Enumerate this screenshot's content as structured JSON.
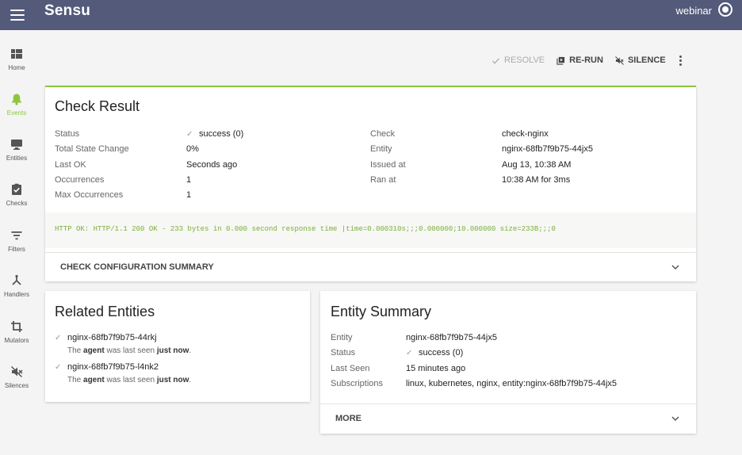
{
  "app": {
    "logo": "Sensu",
    "user": "webinar"
  },
  "sidebar": {
    "items": [
      {
        "label": "Home",
        "icon": "dashboard-icon"
      },
      {
        "label": "Events",
        "icon": "bell-icon",
        "active": true
      },
      {
        "label": "Entities",
        "icon": "monitor-icon"
      },
      {
        "label": "Checks",
        "icon": "clipboard-check-icon"
      },
      {
        "label": "Filters",
        "icon": "filter-icon"
      },
      {
        "label": "Handlers",
        "icon": "fork-icon"
      },
      {
        "label": "Mutators",
        "icon": "crop-icon"
      },
      {
        "label": "Silences",
        "icon": "mute-icon"
      }
    ]
  },
  "toolbar": {
    "resolve": "RESOLVE",
    "rerun": "RE-RUN",
    "silence": "SILENCE"
  },
  "check_result": {
    "title": "Check Result",
    "left": [
      {
        "key": "Status",
        "value": "success (0)"
      },
      {
        "key": "Total State Change",
        "value": "0%"
      },
      {
        "key": "Last OK",
        "value": "Seconds ago"
      },
      {
        "key": "Occurrences",
        "value": "1"
      },
      {
        "key": "Max Occurrences",
        "value": "1"
      }
    ],
    "right": [
      {
        "key": "Check",
        "value": "check-nginx"
      },
      {
        "key": "Entity",
        "value": "nginx-68fb7f9b75-44jx5"
      },
      {
        "key": "Issued at",
        "value": "Aug 13, 10:38 AM"
      },
      {
        "key": "Ran at",
        "value": "10:38 AM for 3ms"
      }
    ],
    "output": "HTTP OK: HTTP/1.1 200 OK - 233 bytes in 0.000 second response time |time=0.000310s;;;0.000000;10.000000 size=233B;;;0",
    "config_summary": "CHECK CONFIGURATION SUMMARY"
  },
  "related_entities": {
    "title": "Related Entities",
    "items": [
      {
        "name": "nginx-68fb7f9b75-44rkj",
        "pre": "The",
        "agent": "agent",
        "mid": "was last seen",
        "when": "just now",
        "post": "."
      },
      {
        "name": "nginx-68fb7f9b75-l4nk2",
        "pre": "The",
        "agent": "agent",
        "mid": "was last seen",
        "when": "just now",
        "post": "."
      }
    ]
  },
  "entity_summary": {
    "title": "Entity Summary",
    "rows": [
      {
        "key": "Entity",
        "value": "nginx-68fb7f9b75-44jx5"
      },
      {
        "key": "Status",
        "value": "success (0)"
      },
      {
        "key": "Last Seen",
        "value": "15 minutes ago"
      },
      {
        "key": "Subscriptions",
        "value": "linux, kubernetes, nginx, entity:nginx-68fb7f9b75-44jx5"
      }
    ],
    "more": "MORE"
  },
  "colors": {
    "appbar": "#545a7a",
    "accent": "#8cc63f",
    "output_text": "#7cae3a"
  }
}
